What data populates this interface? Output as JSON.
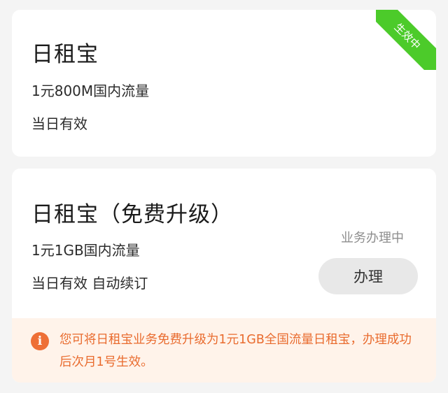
{
  "cards": [
    {
      "title": "日租宝",
      "line1": "1元800M国内流量",
      "line2": "当日有效",
      "ribbon": "生效中",
      "ribbon_color": "#4ccb2a"
    },
    {
      "title": "日租宝（免费升级）",
      "line1": "1元1GB国内流量",
      "line2": "当日有效 自动续订",
      "status": "业务办理中",
      "button_label": "办理",
      "notice": {
        "icon": "info-icon",
        "icon_glyph": "i",
        "text": "您可将日租宝业务免费升级为1元1GB全国流量日租宝，办理成功后次月1号生效。",
        "color": "#e96b2e"
      }
    }
  ]
}
